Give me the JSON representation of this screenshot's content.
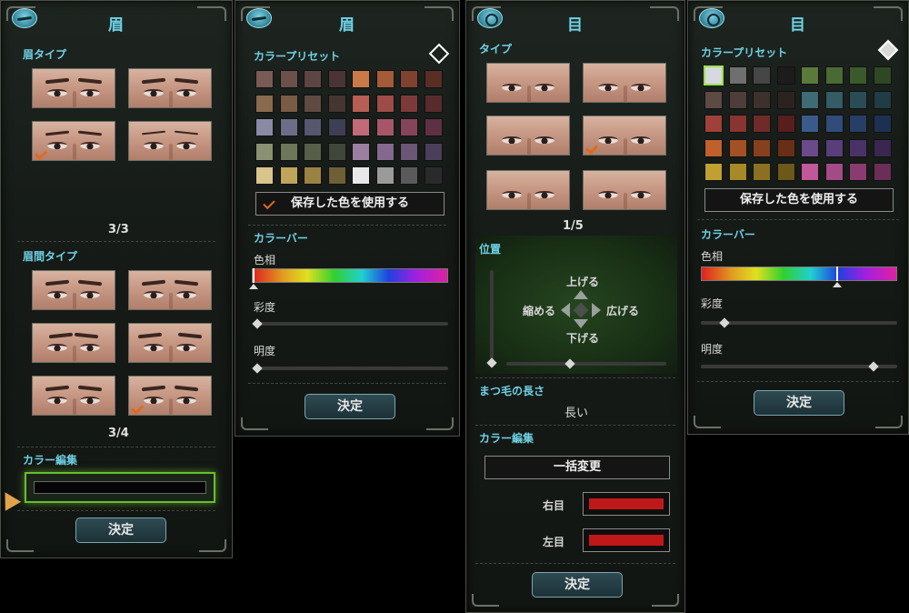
{
  "panel1": {
    "title": "眉",
    "icon": "eyebrow-icon",
    "brow_type_label": "眉タイプ",
    "brow_type_counter": "3/3",
    "brow_gap_label": "眉間タイプ",
    "brow_gap_counter": "3/4",
    "color_edit_label": "カラー編集",
    "confirm_label": "決定"
  },
  "panel2": {
    "title": "眉",
    "icon": "eyebrow-icon",
    "preset_label": "カラープリセット",
    "saved_color_label": "保存した色を使用する",
    "color_bar_label": "カラーバー",
    "hue_label": "色相",
    "saturation_label": "彩度",
    "brightness_label": "明度",
    "confirm_label": "決定",
    "hue_value": 0.0,
    "saturation_value": 0.0,
    "brightness_value": 0.0,
    "swatches": [
      [
        "#7a5a55",
        "#6b5149",
        "#5e4543",
        "#4b3436",
        "#c97a48",
        "#a55b38",
        "#7f4230",
        "#5a2e24"
      ],
      [
        "#8a6a4d",
        "#7a5b45",
        "#5e4a40",
        "#453631",
        "#b65e53",
        "#9d4c47",
        "#7c3b3a",
        "#5a2b2c"
      ],
      [
        "#8a8aa6",
        "#6d6d8a",
        "#57576f",
        "#3e3e54",
        "#c2697a",
        "#a7566a",
        "#85445a",
        "#5e3044"
      ],
      [
        "#8a9073",
        "#6f775a",
        "#585f48",
        "#40463a",
        "#9a7fa0",
        "#836a8d",
        "#6a5676",
        "#4a3e58"
      ],
      [
        "#d9c58a",
        "#bfa45c",
        "#9a8242",
        "#6f5f36",
        "#e8e8ea",
        "#9a9a9c",
        "#5a5a5c",
        "#2a2a2c"
      ]
    ]
  },
  "panel3": {
    "title": "目",
    "icon": "eye-icon",
    "type_label": "タイプ",
    "type_counter": "1/5",
    "position_label": "位置",
    "up_label": "上げる",
    "down_label": "下げる",
    "shrink_label": "縮める",
    "widen_label": "広げる",
    "lash_length_label": "まつ毛の長さ",
    "lash_length_value": "長い",
    "color_edit_label": "カラー編集",
    "batch_change_label": "一括変更",
    "right_eye_label": "右目",
    "left_eye_label": "左目",
    "right_eye_color": "#c01818",
    "left_eye_color": "#c01818",
    "confirm_label": "決定"
  },
  "panel4": {
    "title": "目",
    "icon": "eye-icon",
    "preset_label": "カラープリセット",
    "saved_color_label": "保存した色を使用する",
    "color_bar_label": "カラーバー",
    "hue_label": "色相",
    "saturation_label": "彩度",
    "brightness_label": "明度",
    "confirm_label": "決定",
    "hue_value": 0.69,
    "saturation_value": 0.1,
    "brightness_value": 0.88,
    "swatches": [
      [
        "#d8d8e0",
        "#6f6f6f",
        "#464646",
        "#1c1c1c",
        "#5a7a3a",
        "#4a6a34",
        "#3a5a2c",
        "#2e4824"
      ],
      [
        "#5e4a44",
        "#4e3d39",
        "#3d302d",
        "#2c2320",
        "#3f6b74",
        "#335c66",
        "#2a4c56",
        "#203c44"
      ],
      [
        "#a0403a",
        "#883430",
        "#702a28",
        "#581e1e",
        "#3a5a8a",
        "#304d7a",
        "#263f66",
        "#1c3152"
      ],
      [
        "#c0602a",
        "#a45024",
        "#86401e",
        "#682e16",
        "#6a4a8a",
        "#5a3e7a",
        "#4a3266",
        "#3a2650"
      ],
      [
        "#c0a030",
        "#a68a28",
        "#8a7020",
        "#6c5818",
        "#c0589a",
        "#a44a86",
        "#883c70",
        "#6a2e58"
      ]
    ]
  }
}
